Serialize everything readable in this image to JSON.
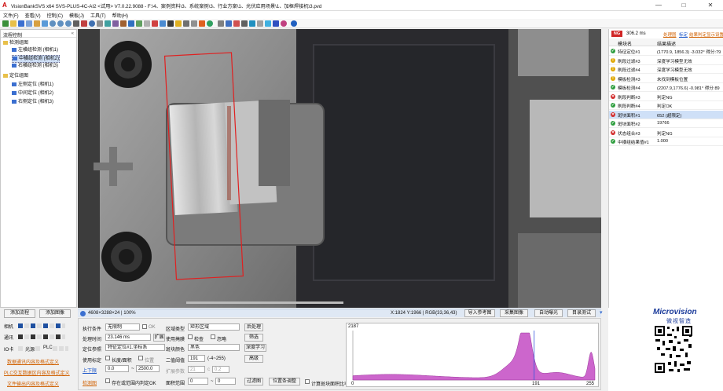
{
  "window": {
    "title": "VisionBankSVS x64 SVS-PLUS-4C-AI2 <试用> V7.0.22.9088 - F:\\4、案例资料\\3、系统案例\\3、行业方案\\1、光伏应用场景\\1、加框焊接机\\3.pvd",
    "logo": "A"
  },
  "window_controls": {
    "minimize": "—",
    "maximize": "□",
    "close": "✕"
  },
  "menu": [
    "文件(F)",
    "查看(V)",
    "控制(C)",
    "模板(J)",
    "工具(T)",
    "帮助(H)"
  ],
  "left_panel": {
    "header": "流程控制",
    "groups": [
      {
        "label": "检测组图",
        "items": [
          "左横组检测 (相机1)",
          "中横组检测 (相机2)",
          "右横组检测 (相机3)"
        ]
      },
      {
        "label": "定位组图",
        "items": [
          "左侧定位 (相机1)",
          "中间定位 (相机2)",
          "右侧定位 (相机3)"
        ]
      }
    ],
    "add_flow": "添加流程",
    "add_group": "添加图像",
    "device_rows": [
      {
        "label": "相机"
      },
      {
        "label": "通讯"
      },
      {
        "label": "IO卡",
        "extra1": "光源",
        "extra2": "PLC"
      }
    ],
    "links": [
      "数据通讯内容及格式定义",
      "PLC交互数据区内容及格式定义",
      "文件输出内容及格式定义"
    ]
  },
  "status_bar": {
    "info": "4608×3288×24 | 100%",
    "coords": "X:1824 Y:1966 | RGB(33,36,43)",
    "buttons": [
      "导入参考图",
      "采集图像",
      "自动曝光",
      "目录测试"
    ]
  },
  "bottom_panel": {
    "exec_cond_label": "执行条件",
    "exec_cond_value": "无限制",
    "ok_label": "OK",
    "proc_time_label": "处理时间",
    "proc_time_value": "23.146 ms",
    "expand": "扩展",
    "loc_ref_label": "定位参照",
    "loc_ref_value": "特征定位#1.坐标系",
    "use_spec_label": "使用标定",
    "len_area": "长度/面积",
    "pos": "位置",
    "upper_label": "上下限",
    "lower_val": "0.0",
    "tilde": "~",
    "upper_val": "2500.0",
    "detect_label": "检测图",
    "in_area_label": "存在或范围内判定OK",
    "region_type_label": "区域类型",
    "region_type_value": "矩形区域",
    "post_proc": "后处理",
    "use_mask_label": "使用掩膜",
    "check1": "检查",
    "ignore": "忽略",
    "filter": "筛选",
    "spot_color_label": "斑块颜色",
    "spot_color_value": "黑色",
    "deep_learn": "深度学习",
    "binar_label": "二值阈值",
    "binar_value": "191",
    "range_hint": "(-4~255)",
    "advanced": "高级",
    "expand_param_label": "扩展参数",
    "exp_v1": "21",
    "exp_v2": "0.2",
    "area_range_label": "面积范围",
    "area_lo": "0",
    "area_hi": "0",
    "filter_img": "过滤图",
    "pos_adjust": "位置条调整",
    "calc_ratio": "计算斑块面积比率"
  },
  "histogram": {
    "max_label": "2187",
    "x_min": "0",
    "x_marker": "191",
    "x_max": "255",
    "threshold": 191,
    "fill_color": "#cc66cc",
    "line_color": "#3355dd"
  },
  "right_panel": {
    "ng_badge": "NG",
    "time": "306.2 ms",
    "links": [
      "处理图",
      "标定",
      "结果判定",
      "显示设置"
    ],
    "col_name": "模块名",
    "col_desc": "结果描述",
    "rows": [
      {
        "status": "ok",
        "name": "特征定位#1",
        "desc": "(1770.9, 1856.3) -3.032° 得分:79"
      },
      {
        "status": "warn",
        "name": "刷段过滤#3",
        "desc": "深度学习模型无效"
      },
      {
        "status": "warn",
        "name": "刷段过滤#4",
        "desc": "深度学习模型无效"
      },
      {
        "status": "warn",
        "name": "模板检测#3",
        "desc": "未找到模板位置"
      },
      {
        "status": "ok",
        "name": "模板检测#4",
        "desc": "(2207.9,1776.6) -0.981° 得分:89"
      },
      {
        "status": "ng",
        "name": "刷段判断#3",
        "desc": "判定NG"
      },
      {
        "status": "ok",
        "name": "刷段判断#4",
        "desc": "判定OK"
      },
      {
        "status": "ngsel",
        "name": "斑块面积#1",
        "desc": "652 (超限定)"
      },
      {
        "status": "ok",
        "name": "斑块面积#2",
        "desc": "19766"
      },
      {
        "status": "ng",
        "name": "状态组合#3",
        "desc": "判定NG"
      },
      {
        "status": "ok",
        "name": "中横组结果值#1",
        "desc": "1.000"
      }
    ]
  },
  "brand": {
    "name": "Microvision",
    "cn": "微视智造"
  },
  "colors": {
    "ok": "#2e9e3e",
    "warn": "#e0a800",
    "ng": "#d02525",
    "selected_row": "#cfe0f7",
    "roi": "#e02020"
  }
}
